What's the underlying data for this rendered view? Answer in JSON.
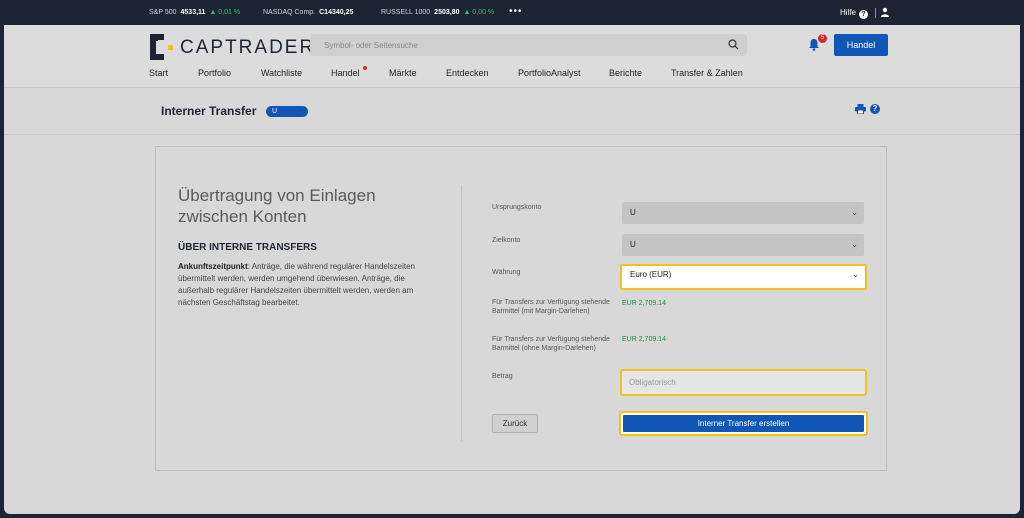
{
  "ticker": {
    "items": [
      {
        "label": "S&P 500",
        "value": "4533,11",
        "change": "▲ 0,01 %"
      },
      {
        "label": "NASDAQ Comp.",
        "value": "C14340,25",
        "change": ""
      },
      {
        "label": "RUSSELL 1000",
        "value": "2503,80",
        "change": "▲ 0,00 %"
      }
    ],
    "more": "•••",
    "help_label": "Hilfe",
    "help_icon": "?"
  },
  "header": {
    "logo_text": "CAPTRADER",
    "search_placeholder": "Symbol- oder Seitensuche",
    "notification_count": "5",
    "trade_button": "Handel",
    "nav": [
      "Start",
      "Portfolio",
      "Watchliste",
      "Handel",
      "Märkte",
      "Entdecken",
      "PortfolioAnalyst",
      "Berichte",
      "Transfer & Zahlen"
    ]
  },
  "page": {
    "title": "Interner Transfer",
    "account_badge": "U",
    "help_icon": "?"
  },
  "card": {
    "heading": "Übertragung von Einlagen zwischen Konten",
    "subheading": "ÜBER INTERNE TRANSFERS",
    "body_bold": "Ankunftszeitpunkt",
    "body_text": ": Anträge, die während regulärer Handelszeiten übermittelt werden, werden umgehend überwiesen. Anträge, die außerhalb regulärer Handelszeiten übermittelt werden, werden am nächsten Geschäftstag bearbeitet."
  },
  "form": {
    "source_label": "Ursprungskonto",
    "source_value": "U",
    "target_label": "Zielkonto",
    "target_value": "U",
    "currency_label": "Währung",
    "currency_value": "Euro (EUR)",
    "avail_margin_label": "Für Transfers zur Verfügung stehende Barmittel (mit Margin-Darlehen)",
    "avail_margin_value": "EUR 2,709.14",
    "avail_nomargin_label": "Für Transfers zur Verfügung stehende Barmittel (ohne Margin-Darlehen)",
    "avail_nomargin_value": "EUR 2,709.14",
    "amount_label": "Betrag",
    "amount_placeholder": "Obligatorisch",
    "back_button": "Zurück",
    "submit_button": "Interner Transfer erstellen"
  },
  "colors": {
    "brand_blue": "#1056b5",
    "highlight": "#f2c21b",
    "positive": "#27c26c",
    "dark": "#1e2433"
  }
}
